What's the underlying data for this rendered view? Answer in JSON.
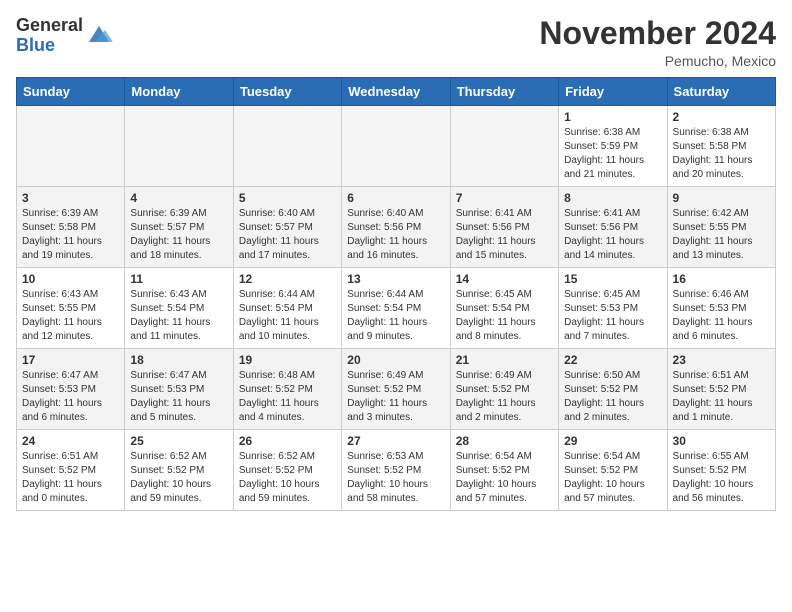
{
  "header": {
    "logo_general": "General",
    "logo_blue": "Blue",
    "month_title": "November 2024",
    "location": "Pemucho, Mexico"
  },
  "weekdays": [
    "Sunday",
    "Monday",
    "Tuesday",
    "Wednesday",
    "Thursday",
    "Friday",
    "Saturday"
  ],
  "weeks": [
    [
      {
        "day": "",
        "info": ""
      },
      {
        "day": "",
        "info": ""
      },
      {
        "day": "",
        "info": ""
      },
      {
        "day": "",
        "info": ""
      },
      {
        "day": "",
        "info": ""
      },
      {
        "day": "1",
        "info": "Sunrise: 6:38 AM\nSunset: 5:59 PM\nDaylight: 11 hours\nand 21 minutes."
      },
      {
        "day": "2",
        "info": "Sunrise: 6:38 AM\nSunset: 5:58 PM\nDaylight: 11 hours\nand 20 minutes."
      }
    ],
    [
      {
        "day": "3",
        "info": "Sunrise: 6:39 AM\nSunset: 5:58 PM\nDaylight: 11 hours\nand 19 minutes."
      },
      {
        "day": "4",
        "info": "Sunrise: 6:39 AM\nSunset: 5:57 PM\nDaylight: 11 hours\nand 18 minutes."
      },
      {
        "day": "5",
        "info": "Sunrise: 6:40 AM\nSunset: 5:57 PM\nDaylight: 11 hours\nand 17 minutes."
      },
      {
        "day": "6",
        "info": "Sunrise: 6:40 AM\nSunset: 5:56 PM\nDaylight: 11 hours\nand 16 minutes."
      },
      {
        "day": "7",
        "info": "Sunrise: 6:41 AM\nSunset: 5:56 PM\nDaylight: 11 hours\nand 15 minutes."
      },
      {
        "day": "8",
        "info": "Sunrise: 6:41 AM\nSunset: 5:56 PM\nDaylight: 11 hours\nand 14 minutes."
      },
      {
        "day": "9",
        "info": "Sunrise: 6:42 AM\nSunset: 5:55 PM\nDaylight: 11 hours\nand 13 minutes."
      }
    ],
    [
      {
        "day": "10",
        "info": "Sunrise: 6:43 AM\nSunset: 5:55 PM\nDaylight: 11 hours\nand 12 minutes."
      },
      {
        "day": "11",
        "info": "Sunrise: 6:43 AM\nSunset: 5:54 PM\nDaylight: 11 hours\nand 11 minutes."
      },
      {
        "day": "12",
        "info": "Sunrise: 6:44 AM\nSunset: 5:54 PM\nDaylight: 11 hours\nand 10 minutes."
      },
      {
        "day": "13",
        "info": "Sunrise: 6:44 AM\nSunset: 5:54 PM\nDaylight: 11 hours\nand 9 minutes."
      },
      {
        "day": "14",
        "info": "Sunrise: 6:45 AM\nSunset: 5:54 PM\nDaylight: 11 hours\nand 8 minutes."
      },
      {
        "day": "15",
        "info": "Sunrise: 6:45 AM\nSunset: 5:53 PM\nDaylight: 11 hours\nand 7 minutes."
      },
      {
        "day": "16",
        "info": "Sunrise: 6:46 AM\nSunset: 5:53 PM\nDaylight: 11 hours\nand 6 minutes."
      }
    ],
    [
      {
        "day": "17",
        "info": "Sunrise: 6:47 AM\nSunset: 5:53 PM\nDaylight: 11 hours\nand 6 minutes."
      },
      {
        "day": "18",
        "info": "Sunrise: 6:47 AM\nSunset: 5:53 PM\nDaylight: 11 hours\nand 5 minutes."
      },
      {
        "day": "19",
        "info": "Sunrise: 6:48 AM\nSunset: 5:52 PM\nDaylight: 11 hours\nand 4 minutes."
      },
      {
        "day": "20",
        "info": "Sunrise: 6:49 AM\nSunset: 5:52 PM\nDaylight: 11 hours\nand 3 minutes."
      },
      {
        "day": "21",
        "info": "Sunrise: 6:49 AM\nSunset: 5:52 PM\nDaylight: 11 hours\nand 2 minutes."
      },
      {
        "day": "22",
        "info": "Sunrise: 6:50 AM\nSunset: 5:52 PM\nDaylight: 11 hours\nand 2 minutes."
      },
      {
        "day": "23",
        "info": "Sunrise: 6:51 AM\nSunset: 5:52 PM\nDaylight: 11 hours\nand 1 minute."
      }
    ],
    [
      {
        "day": "24",
        "info": "Sunrise: 6:51 AM\nSunset: 5:52 PM\nDaylight: 11 hours\nand 0 minutes."
      },
      {
        "day": "25",
        "info": "Sunrise: 6:52 AM\nSunset: 5:52 PM\nDaylight: 10 hours\nand 59 minutes."
      },
      {
        "day": "26",
        "info": "Sunrise: 6:52 AM\nSunset: 5:52 PM\nDaylight: 10 hours\nand 59 minutes."
      },
      {
        "day": "27",
        "info": "Sunrise: 6:53 AM\nSunset: 5:52 PM\nDaylight: 10 hours\nand 58 minutes."
      },
      {
        "day": "28",
        "info": "Sunrise: 6:54 AM\nSunset: 5:52 PM\nDaylight: 10 hours\nand 57 minutes."
      },
      {
        "day": "29",
        "info": "Sunrise: 6:54 AM\nSunset: 5:52 PM\nDaylight: 10 hours\nand 57 minutes."
      },
      {
        "day": "30",
        "info": "Sunrise: 6:55 AM\nSunset: 5:52 PM\nDaylight: 10 hours\nand 56 minutes."
      }
    ]
  ]
}
